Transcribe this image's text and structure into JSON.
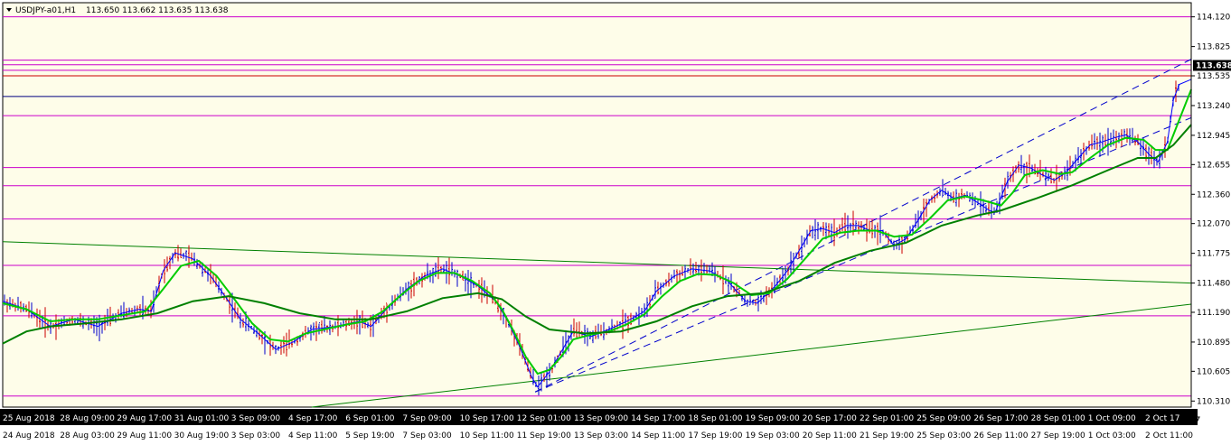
{
  "chart_data": {
    "type": "line",
    "header": {
      "symbol_timeframe": "USDJPY-a01,H1",
      "ohlc": "113.650 113.662 113.635 113.638"
    },
    "current_price": "113.638",
    "ylim": [
      110.25,
      114.26
    ],
    "y_ticks": [
      "114.120",
      "113.825",
      "113.535",
      "113.240",
      "112.945",
      "112.655",
      "112.360",
      "112.070",
      "111.775",
      "111.480",
      "111.190",
      "110.895",
      "110.605",
      "110.310"
    ],
    "x_ticks_top": [
      "25 Aug 2018",
      "28 Aug 09:00",
      "29 Aug 17:00",
      "31 Aug 01:00",
      "3 Sep 09:00",
      "4 Sep 17:00",
      "6 Sep 01:00",
      "7 Sep 09:00",
      "10 Sep 17:00",
      "12 Sep 01:00",
      "13 Sep 09:00",
      "14 Sep 17:00",
      "18 Sep 01:00",
      "19 Sep 09:00",
      "20 Sep 17:00",
      "22 Sep 01:00",
      "25 Sep 09:00",
      "26 Sep 17:00",
      "28 Sep 01:00",
      "1 Oct 09:00",
      "2 Oct 17"
    ],
    "x_ticks_bottom": [
      "24 Aug 2018",
      "28 Aug 03:00",
      "29 Aug 11:00",
      "30 Aug 19:00",
      "3 Sep 03:00",
      "4 Sep 11:00",
      "5 Sep 19:00",
      "7 Sep 03:00",
      "10 Sep 11:00",
      "11 Sep 19:00",
      "13 Sep 03:00",
      "14 Sep 11:00",
      "17 Sep 19:00",
      "19 Sep 03:00",
      "20 Sep 11:00",
      "21 Sep 19:00",
      "25 Sep 03:00",
      "26 Sep 11:00",
      "27 Sep 19:00",
      "1 Oct 03:00",
      "2 Oct 11:00"
    ],
    "horizontal_levels": [
      {
        "price": 114.12,
        "color": "#cc00cc"
      },
      {
        "price": 113.69,
        "color": "#cc00cc"
      },
      {
        "price": 113.645,
        "color": "#cc00cc"
      },
      {
        "price": 113.59,
        "color": "#cc00cc"
      },
      {
        "price": 113.535,
        "color": "#cc0000"
      },
      {
        "price": 113.33,
        "color": "#000080"
      },
      {
        "price": 113.14,
        "color": "#cc00cc"
      },
      {
        "price": 112.625,
        "color": "#cc00cc"
      },
      {
        "price": 112.445,
        "color": "#cc00cc"
      },
      {
        "price": 112.115,
        "color": "#cc00cc"
      },
      {
        "price": 111.655,
        "color": "#cc00cc"
      },
      {
        "price": 111.155,
        "color": "#cc00cc"
      },
      {
        "price": 110.36,
        "color": "#cc00cc"
      }
    ],
    "trend_lines": [
      {
        "style": "dashed",
        "color": "#0000cc",
        "from": [
          0.448,
          110.4
        ],
        "to": [
          1.0,
          113.7
        ]
      },
      {
        "style": "dashed",
        "color": "#0000cc",
        "from": [
          0.448,
          110.4
        ],
        "to": [
          1.0,
          113.12
        ]
      },
      {
        "style": "solid",
        "color": "#008000",
        "from": [
          0.0,
          111.89
        ],
        "to": [
          1.0,
          111.48
        ]
      },
      {
        "style": "solid",
        "color": "#008000",
        "from": [
          0.26,
          110.25
        ],
        "to": [
          1.0,
          111.27
        ]
      }
    ],
    "price_series": [
      [
        0.0,
        111.3
      ],
      [
        0.02,
        111.22
      ],
      [
        0.04,
        111.05
      ],
      [
        0.06,
        111.12
      ],
      [
        0.08,
        111.05
      ],
      [
        0.1,
        111.18
      ],
      [
        0.115,
        111.22
      ],
      [
        0.125,
        111.2
      ],
      [
        0.135,
        111.6
      ],
      [
        0.145,
        111.78
      ],
      [
        0.16,
        111.72
      ],
      [
        0.175,
        111.55
      ],
      [
        0.19,
        111.3
      ],
      [
        0.2,
        111.12
      ],
      [
        0.215,
        110.98
      ],
      [
        0.23,
        110.82
      ],
      [
        0.245,
        110.9
      ],
      [
        0.26,
        111.02
      ],
      [
        0.28,
        111.05
      ],
      [
        0.3,
        111.1
      ],
      [
        0.31,
        111.05
      ],
      [
        0.325,
        111.25
      ],
      [
        0.34,
        111.42
      ],
      [
        0.355,
        111.55
      ],
      [
        0.37,
        111.62
      ],
      [
        0.385,
        111.55
      ],
      [
        0.4,
        111.45
      ],
      [
        0.415,
        111.3
      ],
      [
        0.425,
        111.1
      ],
      [
        0.435,
        110.85
      ],
      [
        0.445,
        110.55
      ],
      [
        0.45,
        110.45
      ],
      [
        0.46,
        110.6
      ],
      [
        0.47,
        110.8
      ],
      [
        0.48,
        111.0
      ],
      [
        0.495,
        110.95
      ],
      [
        0.51,
        111.02
      ],
      [
        0.525,
        111.1
      ],
      [
        0.54,
        111.2
      ],
      [
        0.55,
        111.4
      ],
      [
        0.565,
        111.55
      ],
      [
        0.58,
        111.62
      ],
      [
        0.595,
        111.6
      ],
      [
        0.61,
        111.5
      ],
      [
        0.625,
        111.3
      ],
      [
        0.635,
        111.28
      ],
      [
        0.65,
        111.45
      ],
      [
        0.66,
        111.6
      ],
      [
        0.67,
        111.8
      ],
      [
        0.68,
        112.0
      ],
      [
        0.69,
        112.02
      ],
      [
        0.7,
        111.98
      ],
      [
        0.71,
        112.05
      ],
      [
        0.72,
        112.05
      ],
      [
        0.73,
        112.0
      ],
      [
        0.74,
        112.0
      ],
      [
        0.75,
        111.85
      ],
      [
        0.76,
        111.92
      ],
      [
        0.77,
        112.1
      ],
      [
        0.78,
        112.3
      ],
      [
        0.79,
        112.4
      ],
      [
        0.8,
        112.32
      ],
      [
        0.81,
        112.35
      ],
      [
        0.82,
        112.28
      ],
      [
        0.83,
        112.2
      ],
      [
        0.835,
        112.18
      ],
      [
        0.845,
        112.48
      ],
      [
        0.855,
        112.65
      ],
      [
        0.865,
        112.62
      ],
      [
        0.875,
        112.55
      ],
      [
        0.885,
        112.5
      ],
      [
        0.895,
        112.58
      ],
      [
        0.905,
        112.72
      ],
      [
        0.915,
        112.85
      ],
      [
        0.925,
        112.88
      ],
      [
        0.935,
        112.92
      ],
      [
        0.945,
        112.95
      ],
      [
        0.955,
        112.88
      ],
      [
        0.965,
        112.75
      ],
      [
        0.972,
        112.68
      ],
      [
        0.98,
        112.88
      ],
      [
        0.985,
        113.3
      ],
      [
        0.99,
        113.45
      ],
      [
        1.0,
        113.5
      ]
    ],
    "series": [
      {
        "color": "#0000ff",
        "width": 1
      },
      {
        "color": "#00cc00",
        "width": 2
      },
      {
        "color": "#008000",
        "width": 2
      }
    ],
    "fast_ma": [
      [
        0.0,
        111.28
      ],
      [
        0.02,
        111.22
      ],
      [
        0.04,
        111.1
      ],
      [
        0.06,
        111.12
      ],
      [
        0.08,
        111.12
      ],
      [
        0.1,
        111.16
      ],
      [
        0.12,
        111.2
      ],
      [
        0.135,
        111.42
      ],
      [
        0.15,
        111.65
      ],
      [
        0.165,
        111.7
      ],
      [
        0.18,
        111.55
      ],
      [
        0.195,
        111.32
      ],
      [
        0.21,
        111.08
      ],
      [
        0.225,
        110.92
      ],
      [
        0.24,
        110.9
      ],
      [
        0.255,
        110.98
      ],
      [
        0.27,
        111.02
      ],
      [
        0.29,
        111.07
      ],
      [
        0.305,
        111.1
      ],
      [
        0.32,
        111.2
      ],
      [
        0.335,
        111.36
      ],
      [
        0.35,
        111.5
      ],
      [
        0.365,
        111.58
      ],
      [
        0.38,
        111.58
      ],
      [
        0.395,
        111.5
      ],
      [
        0.41,
        111.38
      ],
      [
        0.42,
        111.22
      ],
      [
        0.43,
        111.0
      ],
      [
        0.44,
        110.75
      ],
      [
        0.45,
        110.58
      ],
      [
        0.46,
        110.62
      ],
      [
        0.47,
        110.75
      ],
      [
        0.48,
        110.92
      ],
      [
        0.495,
        110.97
      ],
      [
        0.51,
        111.0
      ],
      [
        0.525,
        111.07
      ],
      [
        0.54,
        111.17
      ],
      [
        0.555,
        111.35
      ],
      [
        0.57,
        111.5
      ],
      [
        0.585,
        111.57
      ],
      [
        0.6,
        111.56
      ],
      [
        0.615,
        111.48
      ],
      [
        0.63,
        111.36
      ],
      [
        0.645,
        111.38
      ],
      [
        0.66,
        111.52
      ],
      [
        0.675,
        111.72
      ],
      [
        0.69,
        111.92
      ],
      [
        0.705,
        111.98
      ],
      [
        0.72,
        112.0
      ],
      [
        0.735,
        112.0
      ],
      [
        0.75,
        111.94
      ],
      [
        0.765,
        111.96
      ],
      [
        0.78,
        112.12
      ],
      [
        0.795,
        112.3
      ],
      [
        0.81,
        112.34
      ],
      [
        0.825,
        112.3
      ],
      [
        0.84,
        112.25
      ],
      [
        0.85,
        112.38
      ],
      [
        0.86,
        112.55
      ],
      [
        0.875,
        112.6
      ],
      [
        0.89,
        112.56
      ],
      [
        0.9,
        112.58
      ],
      [
        0.915,
        112.72
      ],
      [
        0.93,
        112.85
      ],
      [
        0.945,
        112.92
      ],
      [
        0.96,
        112.9
      ],
      [
        0.97,
        112.8
      ],
      [
        0.98,
        112.8
      ],
      [
        0.99,
        113.1
      ],
      [
        1.0,
        113.4
      ]
    ],
    "slow_ma": [
      [
        0.0,
        110.88
      ],
      [
        0.02,
        111.0
      ],
      [
        0.04,
        111.05
      ],
      [
        0.07,
        111.08
      ],
      [
        0.1,
        111.12
      ],
      [
        0.13,
        111.18
      ],
      [
        0.16,
        111.3
      ],
      [
        0.19,
        111.35
      ],
      [
        0.22,
        111.28
      ],
      [
        0.25,
        111.18
      ],
      [
        0.28,
        111.12
      ],
      [
        0.31,
        111.12
      ],
      [
        0.34,
        111.2
      ],
      [
        0.37,
        111.33
      ],
      [
        0.4,
        111.38
      ],
      [
        0.42,
        111.32
      ],
      [
        0.44,
        111.15
      ],
      [
        0.46,
        111.02
      ],
      [
        0.49,
        110.98
      ],
      [
        0.52,
        111.0
      ],
      [
        0.55,
        111.1
      ],
      [
        0.58,
        111.25
      ],
      [
        0.61,
        111.35
      ],
      [
        0.64,
        111.38
      ],
      [
        0.67,
        111.5
      ],
      [
        0.7,
        111.68
      ],
      [
        0.73,
        111.8
      ],
      [
        0.76,
        111.88
      ],
      [
        0.79,
        112.05
      ],
      [
        0.82,
        112.15
      ],
      [
        0.84,
        112.2
      ],
      [
        0.87,
        112.32
      ],
      [
        0.9,
        112.45
      ],
      [
        0.93,
        112.6
      ],
      [
        0.955,
        112.72
      ],
      [
        0.97,
        112.72
      ],
      [
        0.985,
        112.85
      ],
      [
        1.0,
        113.05
      ]
    ]
  }
}
